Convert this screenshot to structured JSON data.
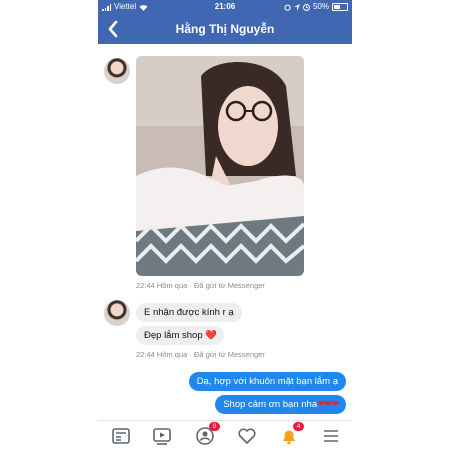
{
  "status_bar": {
    "carrier": "Viettel",
    "time": "21:06",
    "battery": "50%"
  },
  "header": {
    "title": "Hằng Thị Nguyễn"
  },
  "messages": {
    "photo_meta": "22:44 Hôm qua · Đã gửi từ Messenger",
    "in_1": "E nhận được kính r ạ",
    "in_2_text": "Đẹp lắm shop ",
    "in_2_emoji": "❤️",
    "in_meta": "22:44 Hôm qua · Đã gửi từ Messenger",
    "out_1": "Dạ, hợp với khuôn mặt bạn lắm ạ",
    "out_2_text": "Shop cảm ơn bạn nha",
    "out_2_emoji": "❤❤❤"
  },
  "tabbar": {
    "tabs": [
      {
        "icon": "news-feed-icon"
      },
      {
        "icon": "watch-icon"
      },
      {
        "icon": "groups-icon",
        "badge": "8"
      },
      {
        "icon": "dating-heart-icon"
      },
      {
        "icon": "notifications-bell-icon",
        "badge": "4"
      },
      {
        "icon": "menu-icon"
      }
    ]
  },
  "colors": {
    "brand": "#4267b2",
    "outgoing_bubble": "#1e88f0",
    "incoming_bubble": "#eeeeef",
    "badge": "#e41e3f"
  }
}
